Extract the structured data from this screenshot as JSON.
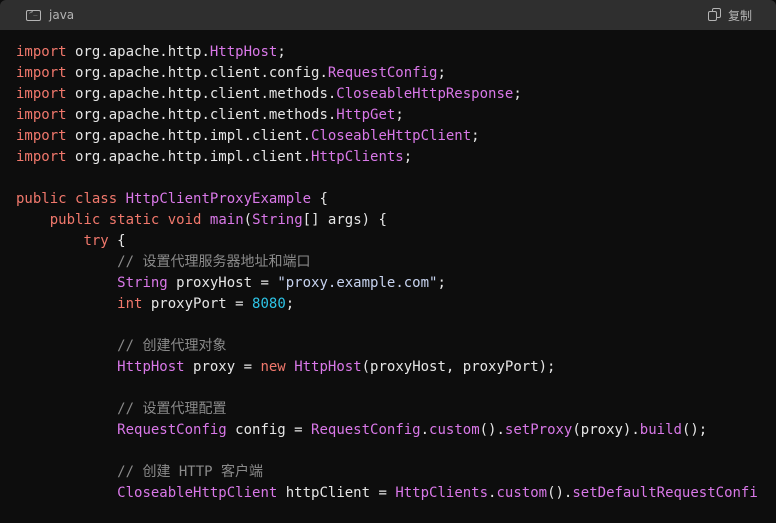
{
  "header": {
    "language": "java",
    "copy_label": "复制"
  },
  "colors": {
    "background": "#0d0d0d",
    "header_bg": "#2f2f2f",
    "keyword": "#f1786c",
    "type": "#d978e8",
    "number": "#2ec4e6",
    "comment": "#8a8a8a",
    "text": "#e6e6e6"
  },
  "code_lines": [
    [
      {
        "t": "import",
        "c": "kw"
      },
      {
        "t": " org.apache.http.",
        "c": "pl"
      },
      {
        "t": "HttpHost",
        "c": "ty"
      },
      {
        "t": ";",
        "c": "pl"
      }
    ],
    [
      {
        "t": "import",
        "c": "kw"
      },
      {
        "t": " org.apache.http.client.config.",
        "c": "pl"
      },
      {
        "t": "RequestConfig",
        "c": "ty"
      },
      {
        "t": ";",
        "c": "pl"
      }
    ],
    [
      {
        "t": "import",
        "c": "kw"
      },
      {
        "t": " org.apache.http.client.methods.",
        "c": "pl"
      },
      {
        "t": "CloseableHttpResponse",
        "c": "ty"
      },
      {
        "t": ";",
        "c": "pl"
      }
    ],
    [
      {
        "t": "import",
        "c": "kw"
      },
      {
        "t": " org.apache.http.client.methods.",
        "c": "pl"
      },
      {
        "t": "HttpGet",
        "c": "ty"
      },
      {
        "t": ";",
        "c": "pl"
      }
    ],
    [
      {
        "t": "import",
        "c": "kw"
      },
      {
        "t": " org.apache.http.impl.client.",
        "c": "pl"
      },
      {
        "t": "CloseableHttpClient",
        "c": "ty"
      },
      {
        "t": ";",
        "c": "pl"
      }
    ],
    [
      {
        "t": "import",
        "c": "kw"
      },
      {
        "t": " org.apache.http.impl.client.",
        "c": "pl"
      },
      {
        "t": "HttpClients",
        "c": "ty"
      },
      {
        "t": ";",
        "c": "pl"
      }
    ],
    [],
    [
      {
        "t": "public",
        "c": "kw"
      },
      {
        "t": " ",
        "c": "pl"
      },
      {
        "t": "class",
        "c": "kw"
      },
      {
        "t": " ",
        "c": "pl"
      },
      {
        "t": "HttpClientProxyExample",
        "c": "ty"
      },
      {
        "t": " {",
        "c": "pl"
      }
    ],
    [
      {
        "t": "    ",
        "c": "pl"
      },
      {
        "t": "public",
        "c": "kw"
      },
      {
        "t": " ",
        "c": "pl"
      },
      {
        "t": "static",
        "c": "kw"
      },
      {
        "t": " ",
        "c": "pl"
      },
      {
        "t": "void",
        "c": "kw"
      },
      {
        "t": " ",
        "c": "pl"
      },
      {
        "t": "main",
        "c": "fn"
      },
      {
        "t": "(",
        "c": "pl"
      },
      {
        "t": "String",
        "c": "ty"
      },
      {
        "t": "[] args) {",
        "c": "pl"
      }
    ],
    [
      {
        "t": "        ",
        "c": "pl"
      },
      {
        "t": "try",
        "c": "kw"
      },
      {
        "t": " {",
        "c": "pl"
      }
    ],
    [
      {
        "t": "            ",
        "c": "pl"
      },
      {
        "t": "// 设置代理服务器地址和端口",
        "c": "cm"
      }
    ],
    [
      {
        "t": "            ",
        "c": "pl"
      },
      {
        "t": "String",
        "c": "ty"
      },
      {
        "t": " proxyHost = ",
        "c": "pl"
      },
      {
        "t": "\"proxy.example.com\"",
        "c": "str"
      },
      {
        "t": ";",
        "c": "pl"
      }
    ],
    [
      {
        "t": "            ",
        "c": "pl"
      },
      {
        "t": "int",
        "c": "kw"
      },
      {
        "t": " proxyPort = ",
        "c": "pl"
      },
      {
        "t": "8080",
        "c": "num"
      },
      {
        "t": ";",
        "c": "pl"
      }
    ],
    [],
    [
      {
        "t": "            ",
        "c": "pl"
      },
      {
        "t": "// 创建代理对象",
        "c": "cm"
      }
    ],
    [
      {
        "t": "            ",
        "c": "pl"
      },
      {
        "t": "HttpHost",
        "c": "ty"
      },
      {
        "t": " proxy = ",
        "c": "pl"
      },
      {
        "t": "new",
        "c": "kw"
      },
      {
        "t": " ",
        "c": "pl"
      },
      {
        "t": "HttpHost",
        "c": "ty"
      },
      {
        "t": "(proxyHost, proxyPort);",
        "c": "pl"
      }
    ],
    [],
    [
      {
        "t": "            ",
        "c": "pl"
      },
      {
        "t": "// 设置代理配置",
        "c": "cm"
      }
    ],
    [
      {
        "t": "            ",
        "c": "pl"
      },
      {
        "t": "RequestConfig",
        "c": "ty"
      },
      {
        "t": " config = ",
        "c": "pl"
      },
      {
        "t": "RequestConfig",
        "c": "ty"
      },
      {
        "t": ".",
        "c": "pl"
      },
      {
        "t": "custom",
        "c": "fn"
      },
      {
        "t": "().",
        "c": "pl"
      },
      {
        "t": "setProxy",
        "c": "fn"
      },
      {
        "t": "(proxy).",
        "c": "pl"
      },
      {
        "t": "build",
        "c": "fn"
      },
      {
        "t": "();",
        "c": "pl"
      }
    ],
    [],
    [
      {
        "t": "            ",
        "c": "pl"
      },
      {
        "t": "// 创建 HTTP 客户端",
        "c": "cm"
      }
    ],
    [
      {
        "t": "            ",
        "c": "pl"
      },
      {
        "t": "CloseableHttpClient",
        "c": "ty"
      },
      {
        "t": " httpClient = ",
        "c": "pl"
      },
      {
        "t": "HttpClients",
        "c": "ty"
      },
      {
        "t": ".",
        "c": "pl"
      },
      {
        "t": "custom",
        "c": "fn"
      },
      {
        "t": "().",
        "c": "pl"
      },
      {
        "t": "setDefaultRequestConfi",
        "c": "fn"
      }
    ]
  ]
}
